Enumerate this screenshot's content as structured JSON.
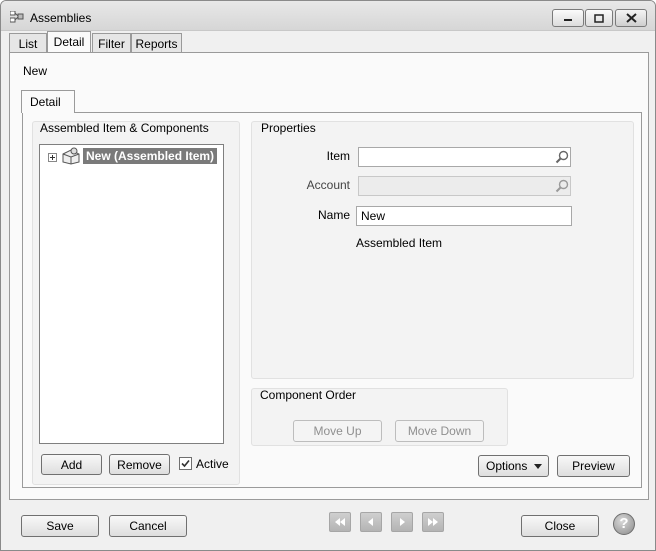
{
  "window": {
    "title": "Assemblies"
  },
  "tabs": [
    {
      "label": "List"
    },
    {
      "label": "Detail"
    },
    {
      "label": "Filter"
    },
    {
      "label": "Reports"
    }
  ],
  "record": {
    "heading": "New"
  },
  "inner_tab": {
    "label": "Detail"
  },
  "components": {
    "title": "Assembled Item & Components",
    "tree_root": "New (Assembled Item)",
    "add_label": "Add",
    "remove_label": "Remove",
    "active_label": "Active",
    "active_checked": true
  },
  "properties": {
    "title": "Properties",
    "item_label": "Item",
    "item_value": "",
    "account_label": "Account",
    "account_value": "",
    "name_label": "Name",
    "name_value": "New",
    "type_text": "Assembled Item"
  },
  "component_order": {
    "title": "Component Order",
    "move_up_label": "Move Up",
    "move_down_label": "Move Down"
  },
  "actions": {
    "options_label": "Options",
    "preview_label": "Preview"
  },
  "footer": {
    "save_label": "Save",
    "cancel_label": "Cancel",
    "close_label": "Close",
    "help_glyph": "?"
  },
  "colors": {
    "selection_bg": "#7a7a7a",
    "selection_text": "#ffffff",
    "disabled_text": "#8f8f8f"
  }
}
